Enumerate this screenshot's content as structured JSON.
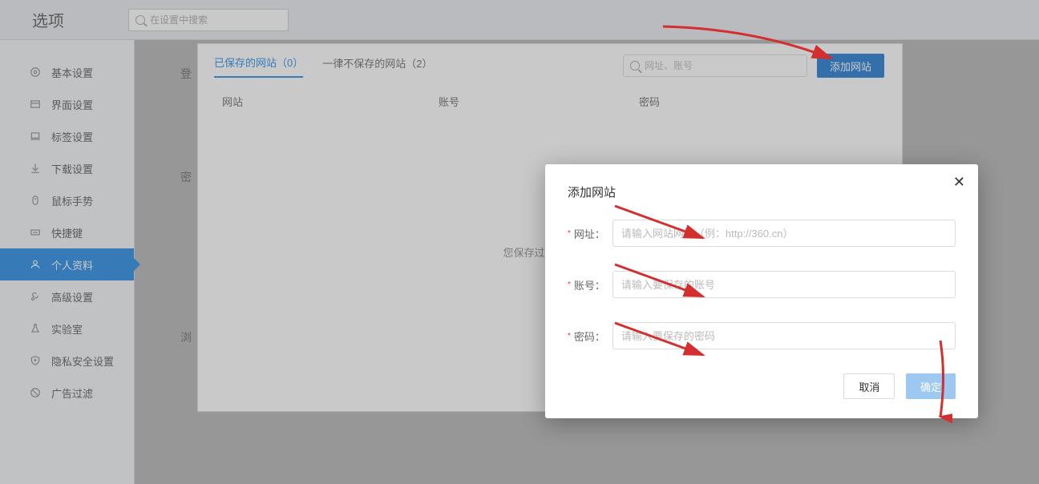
{
  "header": {
    "title": "选项",
    "search_placeholder": "在设置中搜索"
  },
  "sidebar": {
    "items": [
      {
        "label": "基本设置",
        "icon": "gear"
      },
      {
        "label": "界面设置",
        "icon": "window"
      },
      {
        "label": "标签设置",
        "icon": "laptop"
      },
      {
        "label": "下载设置",
        "icon": "download"
      },
      {
        "label": "鼠标手势",
        "icon": "mouse"
      },
      {
        "label": "快捷键",
        "icon": "keyboard"
      },
      {
        "label": "个人资料",
        "icon": "user",
        "active": true
      },
      {
        "label": "高级设置",
        "icon": "wrench"
      },
      {
        "label": "实验室",
        "icon": "flask"
      },
      {
        "label": "隐私安全设置",
        "icon": "shield"
      },
      {
        "label": "广告过滤",
        "icon": "block"
      }
    ]
  },
  "sections": {
    "login": "登",
    "pwd": "密",
    "browse": "浏"
  },
  "tabs": {
    "saved": "已保存的网站（0）",
    "never": "一律不保存的网站（2）"
  },
  "panel": {
    "search_placeholder": "网址、账号",
    "add_button": "添加网站",
    "col_site": "网站",
    "col_account": "账号",
    "col_password": "密码",
    "empty": "您保存过的密码将会"
  },
  "modal": {
    "title": "添加网站",
    "fields": {
      "url_label": "网址：",
      "url_placeholder": "请输入网站网址（例：http://360.cn）",
      "account_label": "账号：",
      "account_placeholder": "请输入要保存的账号",
      "password_label": "密码：",
      "password_placeholder": "请输入要保存的密码"
    },
    "cancel": "取消",
    "confirm": "确定"
  }
}
